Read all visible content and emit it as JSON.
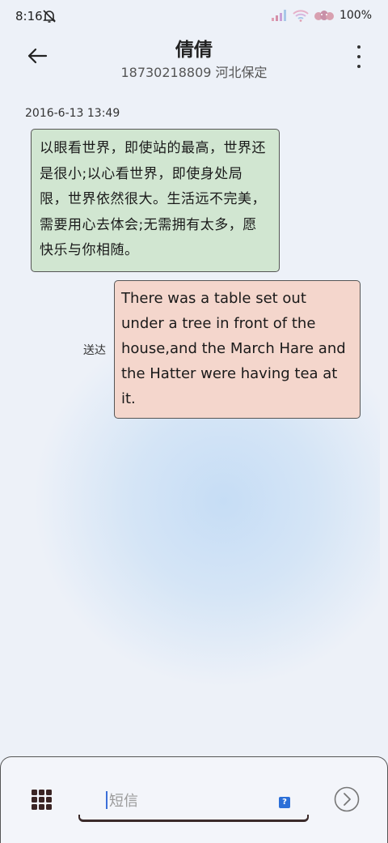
{
  "status_bar": {
    "time": "8:16",
    "battery": "100%"
  },
  "header": {
    "contact_name": "倩倩",
    "contact_detail": "18730218809 河北保定"
  },
  "conversation": {
    "timestamp": "2016-6-13 13:49",
    "received_message": "以眼看世界，即使站的最高，世界还是很小;以心看世界，即使身处局限，世界依然很大。生活远不完美，需要用心去体会;无需拥有太多，愿快乐与你相随。",
    "sent_message": "There was a table set out under a tree in front of the house,and the March Hare and the Hatter were having tea at it.",
    "sent_status": "送达"
  },
  "composer": {
    "placeholder": "短信",
    "sim_label": "?"
  },
  "colors": {
    "received_bubble": "#d1e6d1",
    "sent_bubble": "#f4d6cc",
    "sim_badge": "#2b6fd8"
  }
}
